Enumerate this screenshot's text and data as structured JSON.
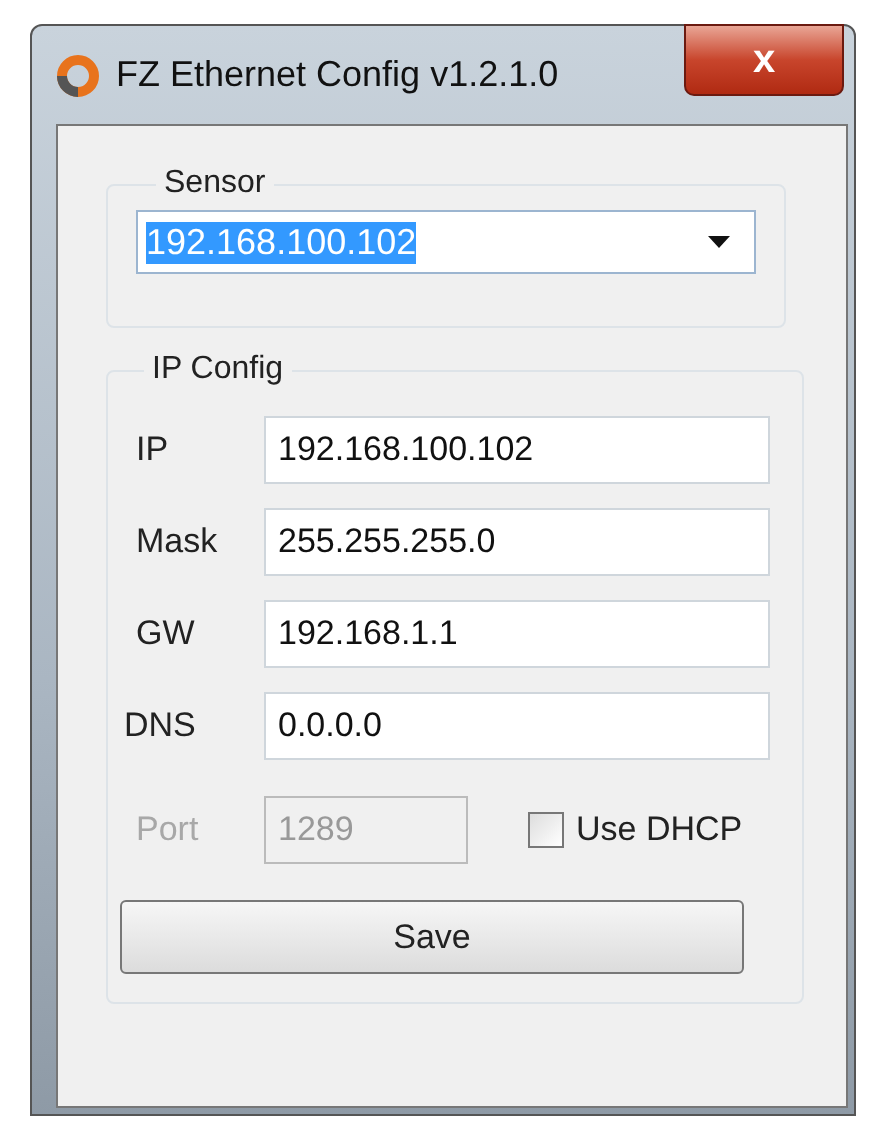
{
  "window": {
    "title": "FZ Ethernet Config v1.2.1.0",
    "close": "x"
  },
  "sensor": {
    "legend": "Sensor",
    "value": "192.168.100.102",
    "highlighted": true
  },
  "ip_config": {
    "legend": "IP Config",
    "fields": [
      {
        "label": "IP",
        "value": "192.168.100.102",
        "disabled": false
      },
      {
        "label": "Mask",
        "value": "255.255.255.0",
        "disabled": false
      },
      {
        "label": "GW",
        "value": "192.168.1.1",
        "disabled": false
      },
      {
        "label": "DNS",
        "value": "0.0.0.0",
        "disabled": false
      }
    ],
    "port": {
      "label": "Port",
      "value": "1289",
      "disabled": true
    },
    "dhcp": {
      "label": "Use DHCP",
      "checked": false
    },
    "save": "Save"
  }
}
